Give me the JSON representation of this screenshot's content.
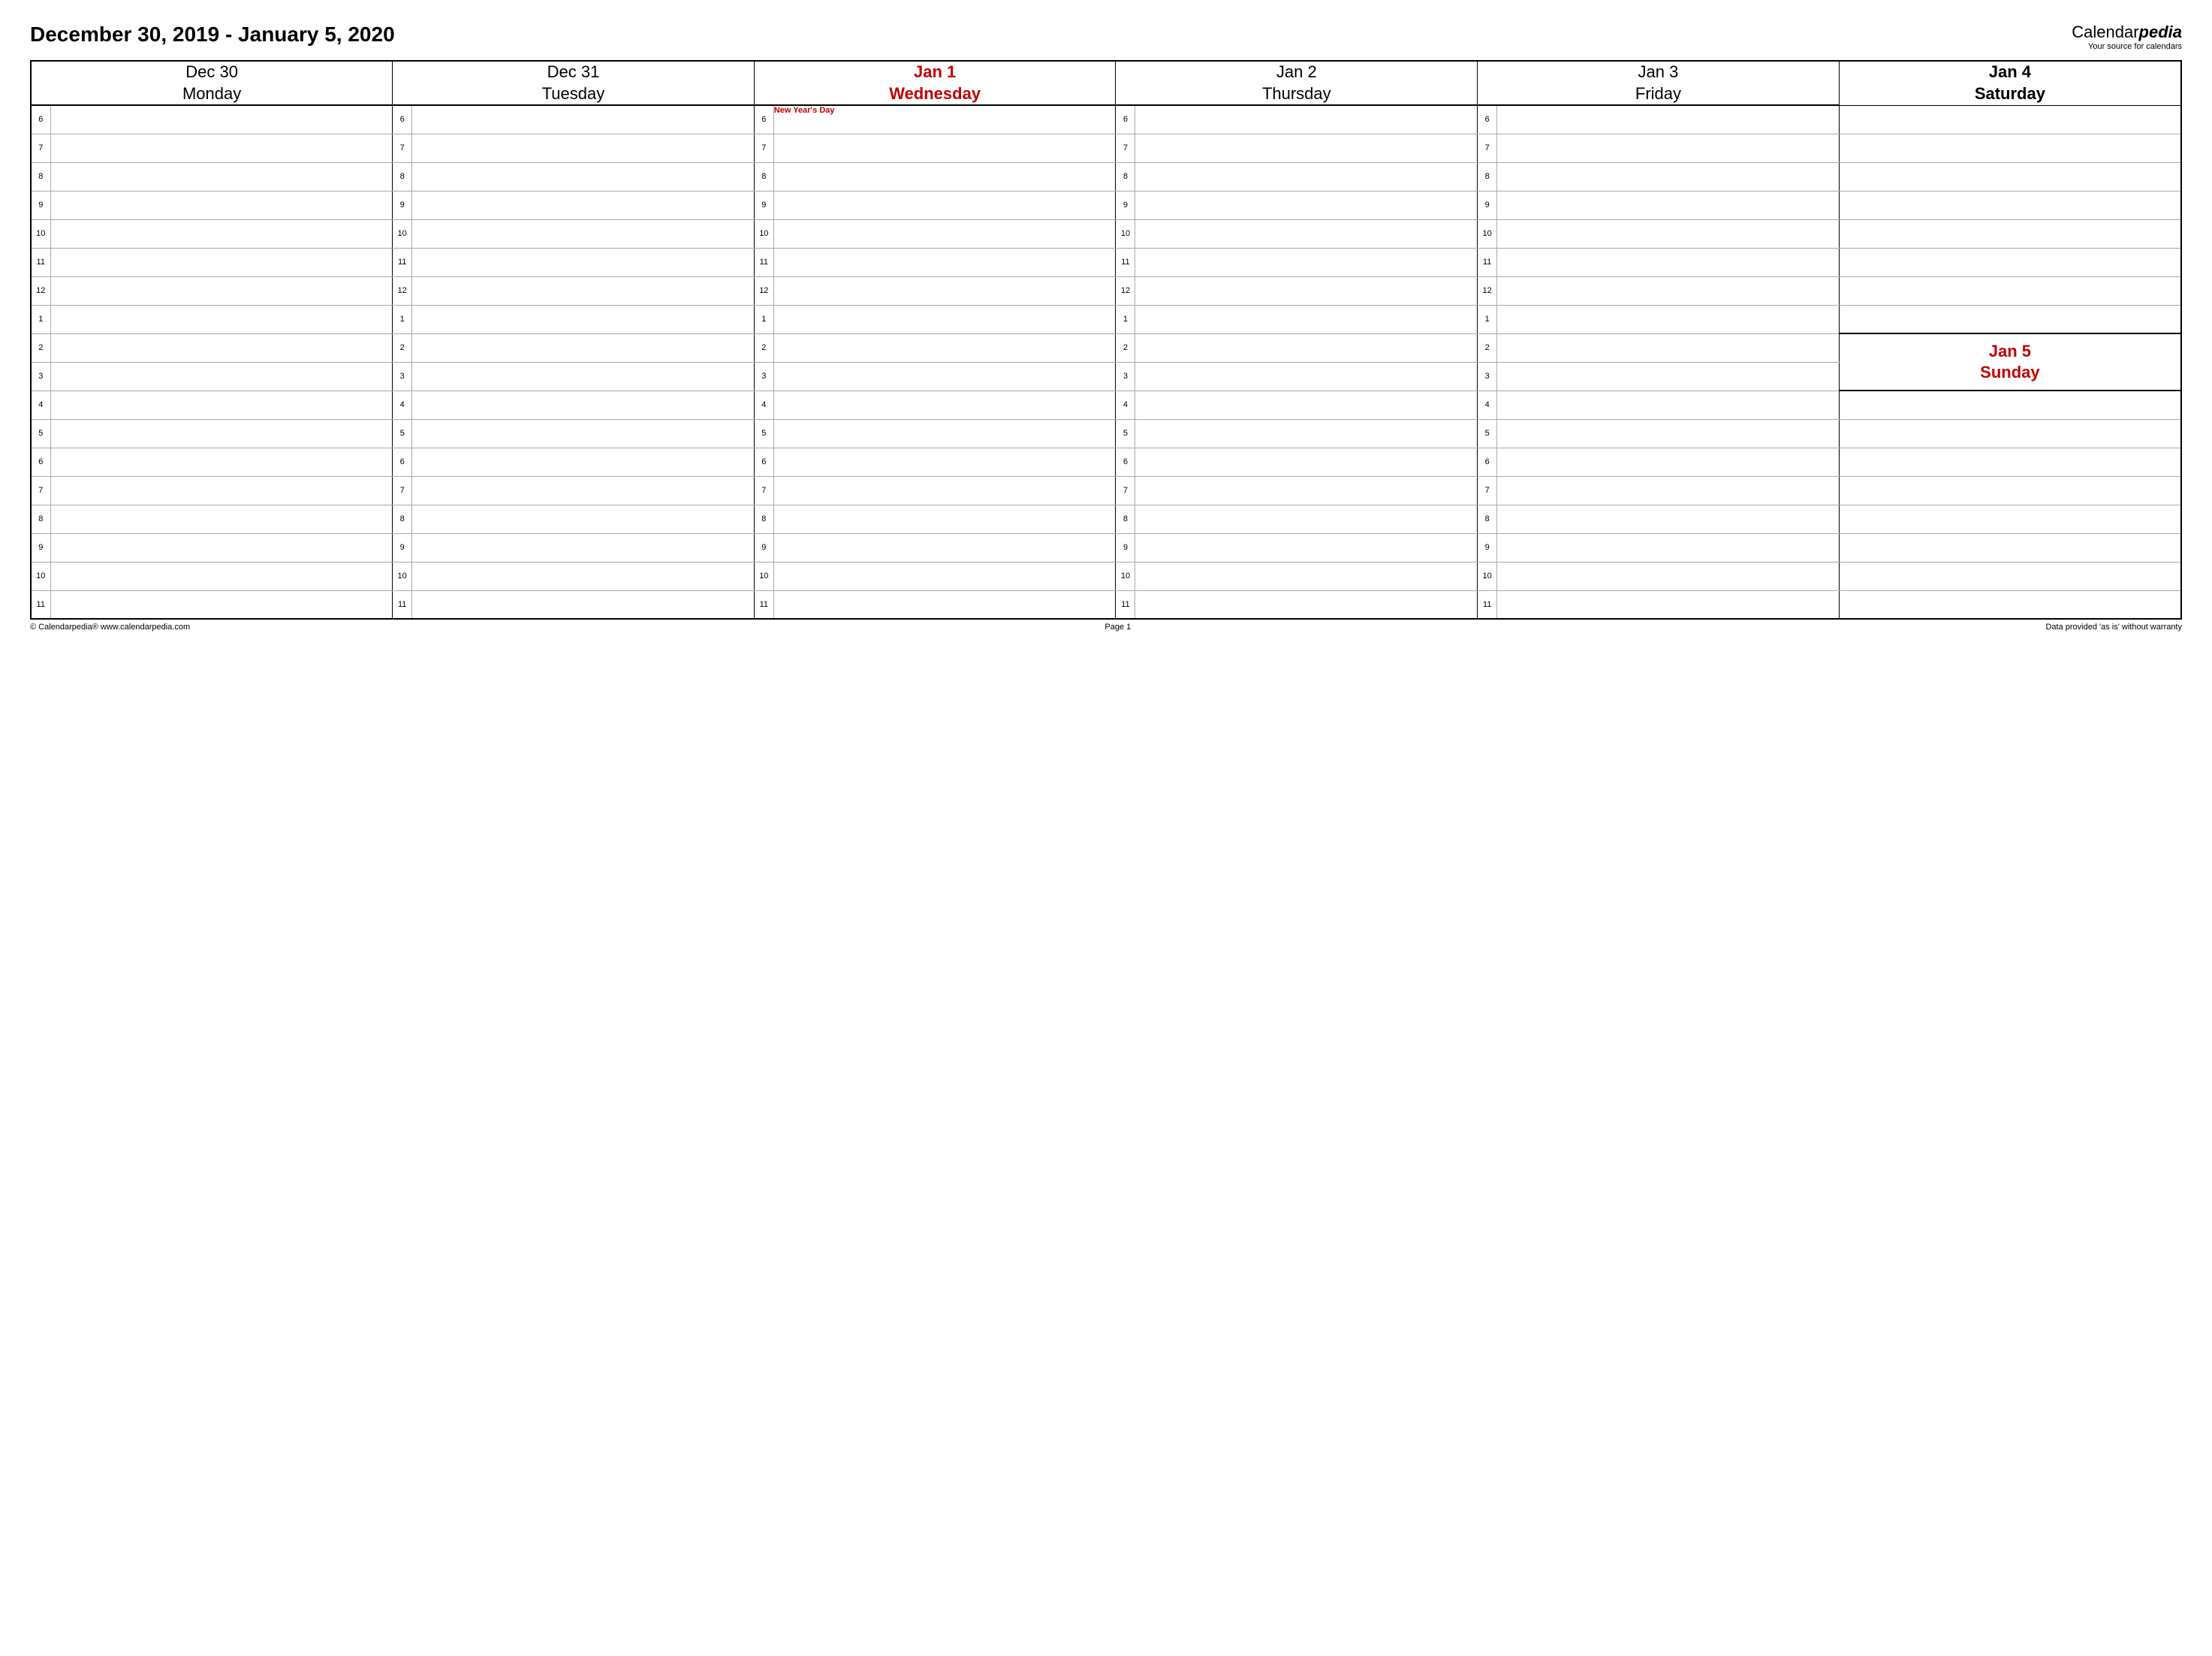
{
  "title": "December 30, 2019 - January 5, 2020",
  "brand": {
    "part1": "Calendar",
    "part2": "pedia",
    "tagline": "Your source for calendars"
  },
  "days": [
    {
      "date": "Dec 30",
      "name": "Monday",
      "holiday": false,
      "weekend": false,
      "note": ""
    },
    {
      "date": "Dec 31",
      "name": "Tuesday",
      "holiday": false,
      "weekend": false,
      "note": ""
    },
    {
      "date": "Jan 1",
      "name": "Wednesday",
      "holiday": true,
      "weekend": false,
      "note": "New Year's Day"
    },
    {
      "date": "Jan 2",
      "name": "Thursday",
      "holiday": false,
      "weekend": false,
      "note": ""
    },
    {
      "date": "Jan 3",
      "name": "Friday",
      "holiday": false,
      "weekend": false,
      "note": ""
    }
  ],
  "saturday": {
    "date": "Jan 4",
    "name": "Saturday"
  },
  "sunday": {
    "date": "Jan 5",
    "name": "Sunday"
  },
  "hours": [
    "6",
    "7",
    "8",
    "9",
    "10",
    "11",
    "12",
    "1",
    "2",
    "3",
    "4",
    "5",
    "6",
    "7",
    "8",
    "9",
    "10",
    "11"
  ],
  "footer": {
    "left": "© Calendarpedia®   www.calendarpedia.com",
    "center": "Page 1",
    "right": "Data provided 'as is' without warranty"
  }
}
